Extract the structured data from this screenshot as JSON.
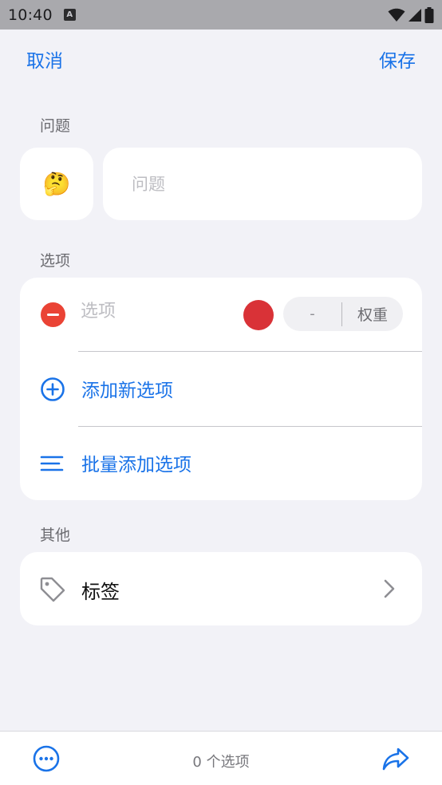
{
  "status_bar": {
    "time": "10:40",
    "badge": "A",
    "icons": [
      "wifi-icon",
      "signal-icon",
      "battery-icon"
    ]
  },
  "nav": {
    "cancel": "取消",
    "save": "保存"
  },
  "question": {
    "section_label": "问题",
    "emoji": "🤔",
    "placeholder": "问题",
    "value": ""
  },
  "options": {
    "section_label": "选项",
    "items": [
      {
        "placeholder": "选项",
        "value": "",
        "color": "#d93237",
        "weight_value": "-",
        "weight_label": "权重"
      }
    ],
    "add_label": "添加新选项",
    "batch_label": "批量添加选项"
  },
  "other": {
    "section_label": "其他",
    "tags_label": "标签"
  },
  "bottom": {
    "count_text": "0 个选项"
  },
  "colors": {
    "accent": "#1a73e8",
    "remove": "#ea4335",
    "option_color": "#d93237",
    "background": "#f2f2f7"
  }
}
